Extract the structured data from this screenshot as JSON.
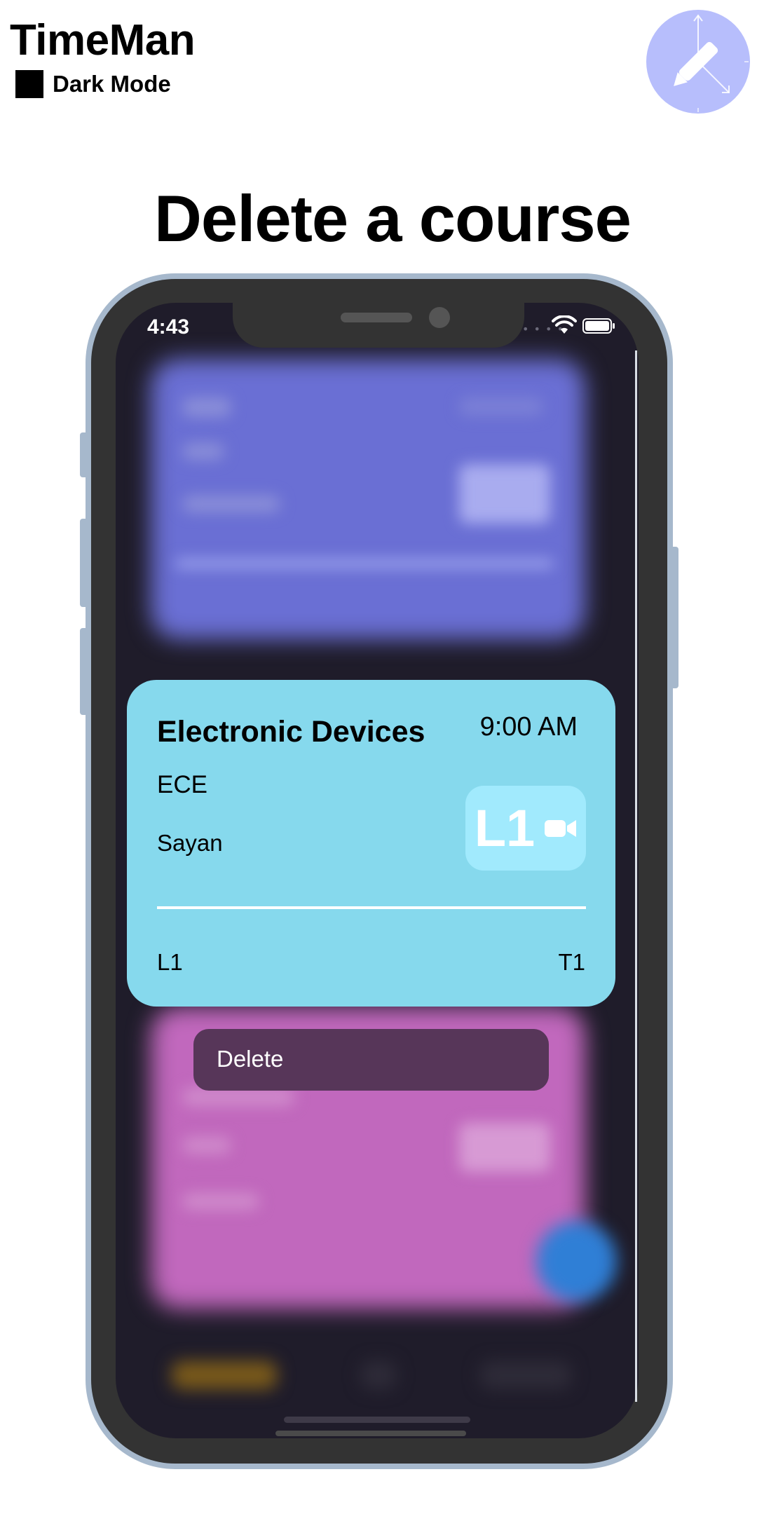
{
  "header": {
    "app_title": "TimeMan",
    "mode_label": "Dark Mode",
    "logo_icon": "pencil-clock-icon"
  },
  "page": {
    "heading": "Delete a course"
  },
  "status_bar": {
    "time": "4:43",
    "icons": [
      "wifi-icon",
      "battery-icon"
    ]
  },
  "course_card": {
    "title": "Electronic Devices",
    "time": "9:00 AM",
    "department": "ECE",
    "teacher": "Sayan",
    "badge_label": "L1",
    "badge_icon": "video-camera-icon",
    "footer_left": "L1",
    "footer_right": "T1"
  },
  "context_menu": {
    "delete_label": "Delete"
  },
  "colors": {
    "card_bg": "#86d9ed",
    "badge_bg": "#a1eafd",
    "menu_bg": "#573659",
    "screen_bg": "#1f1c2a",
    "purple_card": "#6a6fd4",
    "pink_card": "#c168bd",
    "logo_bg": "#b7befc"
  }
}
